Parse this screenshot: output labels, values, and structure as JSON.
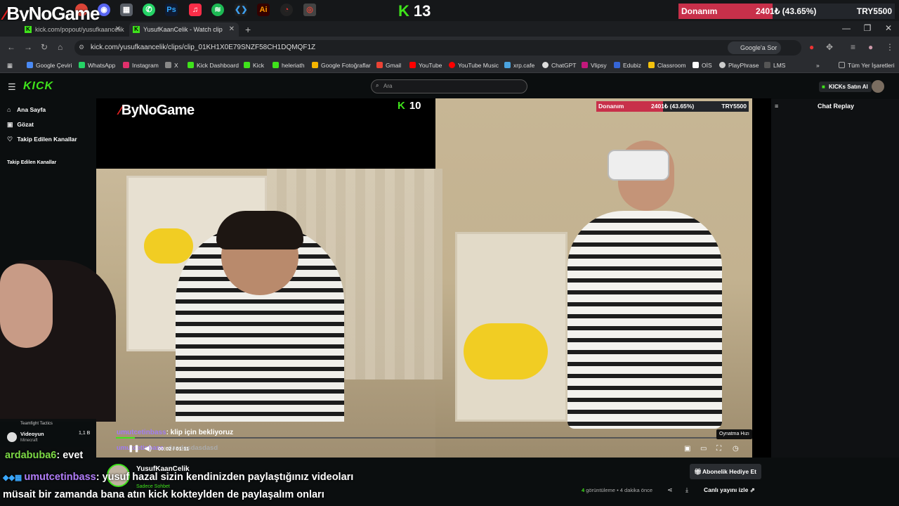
{
  "taskbar": {
    "logo": "ByNoGame",
    "kick_count": "13",
    "hw": {
      "label": "Donanım",
      "percent_text": "2401₺ (43.65%)",
      "percent": 43.65,
      "target": "TRY5500"
    }
  },
  "tabs": [
    {
      "label": "kick.com/popout/yusufkaancelik"
    },
    {
      "label": "YusufKaanCelik - Watch clip"
    }
  ],
  "address": {
    "url": "kick.com/yusufkaancelik/clips/clip_01KH1X0E79SNZF58CH1DQMQF1Z",
    "google": "Google'a Sor"
  },
  "bookmarks": [
    {
      "label": "Google Çeviri",
      "color": "#4a8af4"
    },
    {
      "label": "WhatsApp",
      "color": "#25d366"
    },
    {
      "label": "Instagram",
      "color": "#e1306c"
    },
    {
      "label": "X",
      "color": "#888888"
    },
    {
      "label": "Kick Dashboard",
      "color": "#3fe31b"
    },
    {
      "label": "Kick",
      "color": "#3fe31b"
    },
    {
      "label": "heleriath",
      "color": "#3fe31b"
    },
    {
      "label": "Google Fotoğraflar",
      "color": "#f4b400"
    },
    {
      "label": "Gmail",
      "color": "#ea4335"
    },
    {
      "label": "YouTube",
      "color": "#ff0000"
    },
    {
      "label": "YouTube Music",
      "color": "#ff0000"
    },
    {
      "label": "xrp.cafe",
      "color": "#4aa3df"
    },
    {
      "label": "ChatGPT",
      "color": "#dddddd"
    },
    {
      "label": "Vlipsy",
      "color": "#c2187b"
    },
    {
      "label": "Edubiz",
      "color": "#3565d6"
    },
    {
      "label": "Classroom",
      "color": "#f4c20d"
    },
    {
      "label": "OİS",
      "color": "#ffffff"
    },
    {
      "label": "PlayPhrase",
      "color": "#cccccc"
    },
    {
      "label": "LMS",
      "color": "#555555"
    }
  ],
  "bookmarks_all": "Tüm Yer İşaretleri",
  "kick": {
    "search_placeholder": "Ara",
    "kicks_buy": "KICKs Satın Al",
    "sidebar": {
      "home": "Ana Sayfa",
      "browse": "Gözat",
      "following": "Takip Edilen Kanallar",
      "following_header": "Takip Edilen Kanallar",
      "tft": "Teamfight Tactics",
      "channel": "Videoyun",
      "channel_game": "Minecraft",
      "channel_viewers": "1,1 B"
    },
    "chat_replay": "Chat Replay"
  },
  "video": {
    "overlay_logo": "ByNoGame",
    "overlay_k": "10",
    "overlay_hw": {
      "label": "Donanım",
      "percent_text": "2401₺ (43.65%)",
      "target": "TRY5500"
    },
    "chat_lines": [
      {
        "user": "umutcetinbass",
        "text": ": klip için bekliyoruz"
      },
      {
        "user": "umutcetinbass",
        "text": ": dasdasdasdasd"
      }
    ],
    "time": "00:02 / 01:11",
    "progress": 0.03,
    "speed_tooltip": "Oynatma Hızı"
  },
  "channel": {
    "name": "YusufKaanCelik",
    "sub": "Sadece Sohbet",
    "gift": "Abonelik Hediye Et",
    "views_count": "4",
    "views_label": "görüntüleme",
    "ago": "• 4 dakika önce",
    "live_watch": "Canlı yayını izle"
  },
  "stream_chat": [
    {
      "user": "ardabuba6",
      "text": ": evet"
    },
    {
      "user": "umutcetinbass",
      "text": ": yusuf hazal sizin kendinizden paylaştığınız videoları"
    },
    {
      "user": "",
      "text": "müsait bir zamanda bana atın kick kokteylden de paylaşalım onları"
    }
  ]
}
